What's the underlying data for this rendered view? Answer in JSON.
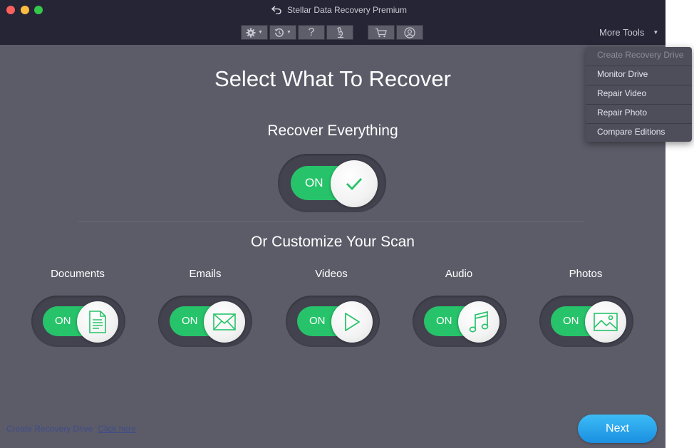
{
  "window": {
    "title": "Stellar Data Recovery Premium"
  },
  "toolbar": {
    "help_label": "?"
  },
  "more_tools": {
    "label": "More Tools",
    "items": [
      {
        "label": "Create Recovery Drive",
        "enabled": false
      },
      {
        "label": "Monitor Drive",
        "enabled": true
      },
      {
        "label": "Repair Video",
        "enabled": true
      },
      {
        "label": "Repair Photo",
        "enabled": true
      },
      {
        "label": "Compare Editions",
        "enabled": true
      }
    ]
  },
  "main": {
    "heading": "Select What To Recover",
    "recover_everything": {
      "label": "Recover Everything",
      "state": "ON"
    },
    "customize_heading": "Or Customize Your Scan",
    "categories": [
      {
        "label": "Documents",
        "state": "ON",
        "icon": "document-icon"
      },
      {
        "label": "Emails",
        "state": "ON",
        "icon": "envelope-icon"
      },
      {
        "label": "Videos",
        "state": "ON",
        "icon": "play-icon"
      },
      {
        "label": "Audio",
        "state": "ON",
        "icon": "music-note-icon"
      },
      {
        "label": "Photos",
        "state": "ON",
        "icon": "picture-icon"
      }
    ]
  },
  "footer": {
    "recovery_drive_text": "Create Recovery Drive",
    "recovery_drive_link": "Click here",
    "next_label": "Next"
  },
  "colors": {
    "toggle_on": "#27c36a",
    "icon_green": "#27c36a",
    "next_button": "#1a8fe0",
    "panel": "#5c5c69",
    "titlebar": "#252535"
  }
}
